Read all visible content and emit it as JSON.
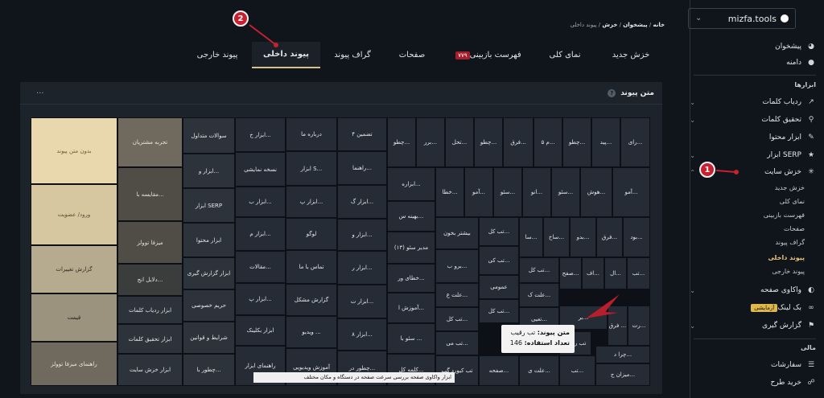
{
  "sidebar": {
    "site": "mizfa.tools",
    "top_items": [
      {
        "label": "پیشخوان",
        "icon": "pie-chart-icon"
      },
      {
        "label": "دامنه",
        "icon": "globe-icon"
      }
    ],
    "tools_header": "ابزارها",
    "tools": [
      {
        "label": "ردیاب کلمات",
        "icon": "line-chart-icon"
      },
      {
        "label": "تحقیق کلمات",
        "icon": "search-icon"
      },
      {
        "label": "ابزار محتوا",
        "icon": "pencil-icon"
      },
      {
        "label": "ابزار SERP",
        "icon": "trophy-icon"
      },
      {
        "label": "خزش سایت",
        "icon": "bug-icon"
      }
    ],
    "crawl_subitems": [
      "خزش جدید",
      "نمای کلی",
      "فهرست بازبینی",
      "صفحات",
      "گراف پیوند",
      "پیوند داخلی",
      "پیوند خارجی"
    ],
    "more_items": [
      {
        "label": "واکاوی صفحه",
        "icon": "gauge-icon"
      },
      {
        "label": "بک لینک",
        "icon": "link-icon",
        "badge": "آزمایشی"
      },
      {
        "label": "گزارش گیری",
        "icon": "flag-icon"
      }
    ],
    "finance_header": "مالی",
    "finance": [
      {
        "label": "سفارشات",
        "icon": "list-icon"
      },
      {
        "label": "خرید طرح",
        "icon": "cart-icon"
      }
    ]
  },
  "breadcrumb": {
    "home": "خانه",
    "dashboard": "پیشخوان",
    "crawl": "خزش",
    "current": "پیوند داخلی"
  },
  "tabs": [
    {
      "label": "خزش جدید"
    },
    {
      "label": "نمای کلی"
    },
    {
      "label": "فهرست بازبینی",
      "badge": "۷۷۹"
    },
    {
      "label": "صفحات"
    },
    {
      "label": "گراف پیوند"
    },
    {
      "label": "پیوند داخلی"
    },
    {
      "label": "پیوند خارجی"
    }
  ],
  "panel": {
    "title": "متن پیوند",
    "more": "..."
  },
  "tooltip": {
    "line1_label": "متن پیوند:",
    "line1_value": "تب رقیب",
    "line2_label": "تعداد استفاده:",
    "line2_value": "146"
  },
  "bottom_tip": "ابزار واکاوی صفحه   بررسی سرعت صفحه در دستگاه و مکان مختلف",
  "markers": [
    "1",
    "2"
  ],
  "chart_data": {
    "type": "heatmap",
    "title": "متن پیوند",
    "cells": [
      "بدون متن پیوند",
      "ورود/ عضویت",
      "گزارش تغییرات",
      "قیمت",
      "راهنمای میزفا توولز",
      "تجربه مشتریان",
      "مقایسه با...",
      "میزفا توولز",
      "دلایل انج...",
      "ابزار ردیاب کلمات",
      "ابزار تحقیق کلمات",
      "ابزار خزش سایت",
      "سوالات متداول",
      "ابزار و...",
      "ابزار SERP",
      "ابزار محتوا",
      "ابزار گزارش گیری",
      "حریم خصوصی",
      "شرایط و قوانین",
      "چطور با...",
      "ابزار خ...",
      "نسخه نمایشی",
      "ابزار ب...",
      "ابزار م...",
      "مقالات...",
      "ابزار پ...",
      "ابزار بکلینک",
      "راهنمای ابزار",
      "درباره ما",
      "ابزار S...",
      "ابزار پ...",
      "لوگو",
      "تماس با ما",
      "گزارش مشکل",
      "ویدیو ...",
      "آموزش ویدیویی",
      "۴ تضمین",
      "راهنما...",
      "ابزار گ...",
      "ابزار و...",
      "ابزار ر...",
      "ابزار ت...",
      "۸ ابزار...",
      "چطور در...",
      "چطو...",
      "برر...",
      "تحل...",
      "چطو...",
      "فرق...",
      "۵ م...",
      "چطو...",
      "پید...",
      "رای...",
      "ابزاره...",
      "بهینه س...",
      "مدیر سئو (۱۳)",
      "خطای ور...",
      "آموزش ا...",
      "سئو با ...",
      "کلمه کل...",
      "خطا...",
      "آمو...",
      "سئو...",
      "انو...",
      "سئو...",
      "هوش...",
      "آمو...",
      "بیشتر بخون",
      "تب کل...",
      "تب کی...",
      "برو ب...",
      "عمومی",
      "تب کل...",
      "علت ک...",
      "تب کل...",
      "تعیی...",
      "علت ع...",
      "تب کل...",
      "تب می...",
      "تب کیورد گپ",
      "صفحه...",
      "علت ی...",
      "سا...",
      "ساخ...",
      "بدو...",
      "فرق...",
      "بود...",
      "صفح...",
      "اف...",
      "ال...",
      "تب...",
      "بر...",
      "تب رقیب",
      "فرق ...",
      "رت...",
      "تب...",
      "چرا د...",
      "میزان ج...",
      "چطور کل..."
    ]
  }
}
